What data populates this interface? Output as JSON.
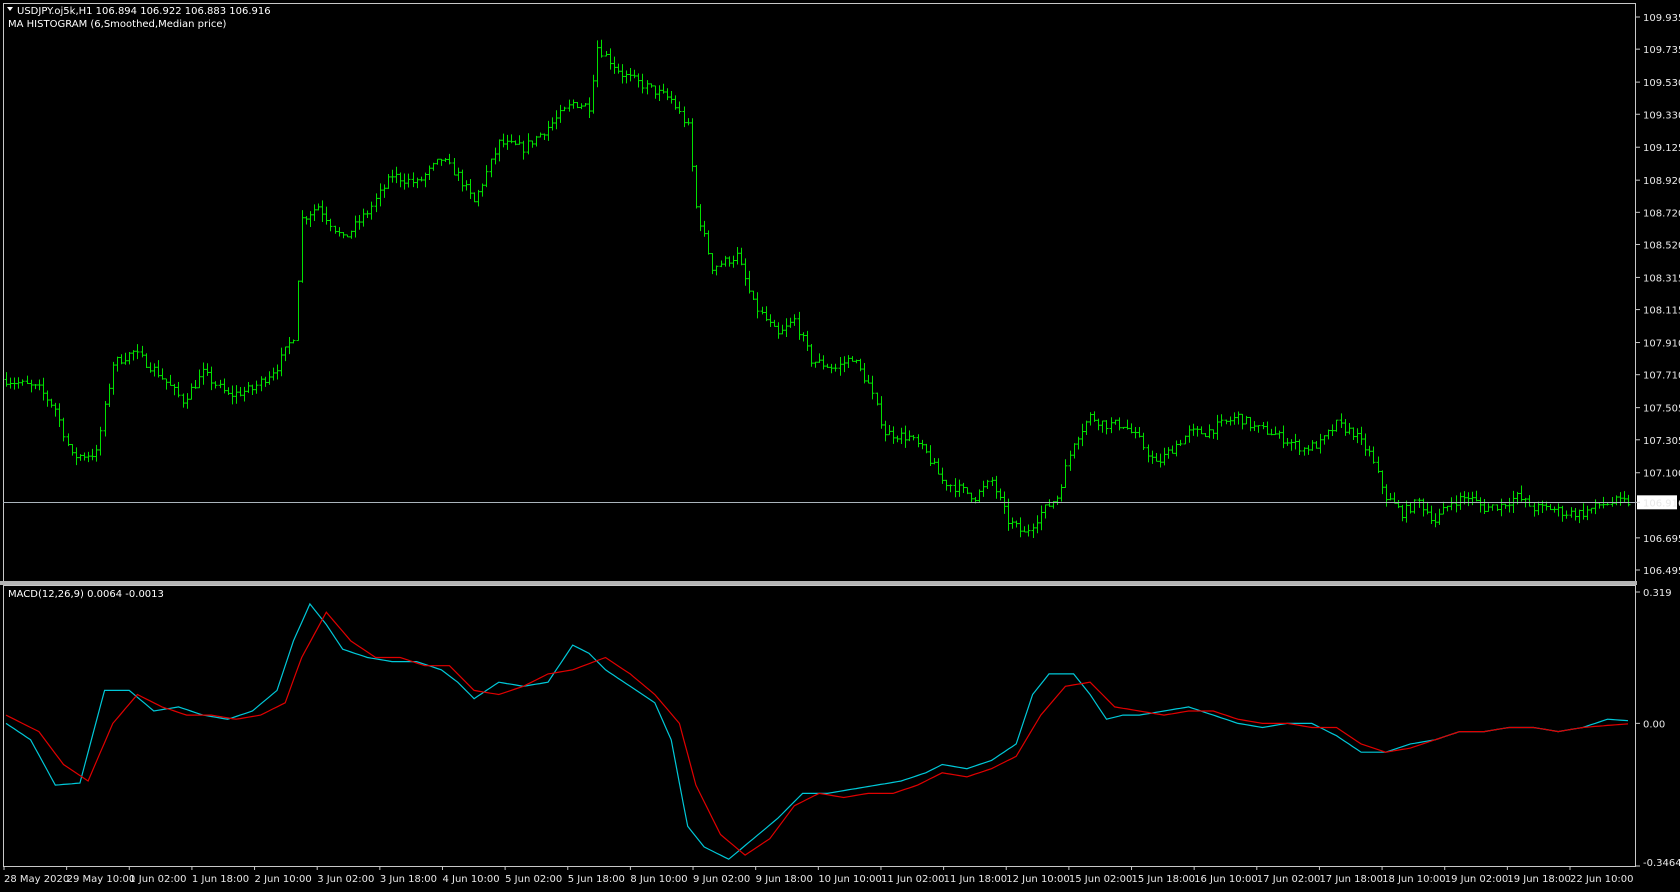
{
  "window": {
    "symbol_line": "USDJPY.oj5k,H1  106.894 106.922 106.883 106.916",
    "indicator_line": "MA HISTOGRAM (6,Smoothed,Median price)"
  },
  "colors": {
    "background": "#000000",
    "candles": "#00e000",
    "macd_main": "#00c8d8",
    "macd_signal": "#e00000",
    "axis_text": "#e8e8e8",
    "current_price_line": "#aab4bc",
    "separator": "#b4b4b4"
  },
  "chart_data": [
    {
      "type": "ohlc",
      "name": "price",
      "title": "USDJPY.oj5k,H1  106.894 106.922 106.883 106.916",
      "ylim": [
        106.495,
        109.935
      ],
      "current_price": 106.916,
      "y_ticks": [
        "109.935",
        "109.735",
        "109.530",
        "109.330",
        "109.125",
        "108.920",
        "108.720",
        "108.520",
        "108.315",
        "108.115",
        "107.910",
        "107.710",
        "107.505",
        "107.305",
        "107.100",
        "106.916",
        "106.695",
        "106.495"
      ],
      "x_ticks": [
        "28 May 2020",
        "29 May 10:00",
        "1 Jun 02:00",
        "1 Jun 18:00",
        "2 Jun 10:00",
        "3 Jun 02:00",
        "3 Jun 18:00",
        "4 Jun 10:00",
        "5 Jun 02:00",
        "5 Jun 18:00",
        "8 Jun 10:00",
        "9 Jun 02:00",
        "9 Jun 18:00",
        "10 Jun 10:00",
        "11 Jun 02:00",
        "11 Jun 18:00",
        "12 Jun 10:00",
        "15 Jun 02:00",
        "15 Jun 18:00",
        "16 Jun 10:00",
        "17 Jun 02:00",
        "17 Jun 18:00",
        "18 Jun 10:00",
        "19 Jun 02:00",
        "19 Jun 18:00",
        "22 Jun 10:00"
      ],
      "key_points": [
        [
          0,
          107.68
        ],
        [
          8,
          107.62
        ],
        [
          12,
          107.5
        ],
        [
          16,
          107.2
        ],
        [
          22,
          107.22
        ],
        [
          26,
          107.78
        ],
        [
          31,
          107.85
        ],
        [
          37,
          107.72
        ],
        [
          43,
          107.55
        ],
        [
          48,
          107.72
        ],
        [
          54,
          107.58
        ],
        [
          60,
          107.62
        ],
        [
          66,
          107.76
        ],
        [
          70,
          107.95
        ],
        [
          72,
          108.68
        ],
        [
          76,
          108.76
        ],
        [
          82,
          108.55
        ],
        [
          88,
          108.72
        ],
        [
          94,
          108.95
        ],
        [
          100,
          108.9
        ],
        [
          106,
          109.05
        ],
        [
          110,
          108.95
        ],
        [
          114,
          108.78
        ],
        [
          120,
          109.15
        ],
        [
          126,
          109.12
        ],
        [
          132,
          109.25
        ],
        [
          138,
          109.4
        ],
        [
          142,
          109.38
        ],
        [
          144,
          109.75
        ],
        [
          150,
          109.58
        ],
        [
          156,
          109.5
        ],
        [
          162,
          109.42
        ],
        [
          166,
          109.25
        ],
        [
          168,
          108.75
        ],
        [
          172,
          108.38
        ],
        [
          178,
          108.45
        ],
        [
          182,
          108.15
        ],
        [
          188,
          107.95
        ],
        [
          192,
          108.05
        ],
        [
          196,
          107.8
        ],
        [
          202,
          107.75
        ],
        [
          206,
          107.82
        ],
        [
          210,
          107.65
        ],
        [
          214,
          107.35
        ],
        [
          220,
          107.32
        ],
        [
          224,
          107.22
        ],
        [
          228,
          107.05
        ],
        [
          232,
          107.0
        ],
        [
          236,
          106.95
        ],
        [
          240,
          107.05
        ],
        [
          244,
          106.8
        ],
        [
          248,
          106.72
        ],
        [
          252,
          106.85
        ],
        [
          256,
          106.95
        ],
        [
          260,
          107.3
        ],
        [
          264,
          107.45
        ],
        [
          268,
          107.4
        ],
        [
          272,
          107.4
        ],
        [
          276,
          107.3
        ],
        [
          280,
          107.15
        ],
        [
          284,
          107.25
        ],
        [
          288,
          107.35
        ],
        [
          292,
          107.35
        ],
        [
          296,
          107.4
        ],
        [
          300,
          107.45
        ],
        [
          304,
          107.38
        ],
        [
          308,
          107.35
        ],
        [
          312,
          107.3
        ],
        [
          316,
          107.25
        ],
        [
          320,
          107.28
        ],
        [
          324,
          107.4
        ],
        [
          328,
          107.35
        ],
        [
          332,
          107.22
        ],
        [
          336,
          106.95
        ],
        [
          340,
          106.85
        ],
        [
          344,
          106.92
        ],
        [
          348,
          106.8
        ],
        [
          352,
          106.92
        ],
        [
          356,
          106.95
        ],
        [
          360,
          106.88
        ],
        [
          364,
          106.9
        ],
        [
          368,
          106.95
        ],
        [
          372,
          106.88
        ],
        [
          376,
          106.88
        ],
        [
          380,
          106.85
        ],
        [
          384,
          106.85
        ],
        [
          388,
          106.9
        ],
        [
          392,
          106.92
        ],
        [
          395,
          106.916
        ]
      ]
    },
    {
      "type": "line",
      "name": "macd",
      "title": "MACD(12,26,9) 0.0064 -0.0013",
      "ylim": [
        -0.3464,
        0.319
      ],
      "y_ticks": [
        "0.319",
        "0.00",
        "-0.3464"
      ],
      "series": [
        {
          "name": "main",
          "values": [
            [
              0,
              0.0
            ],
            [
              6,
              -0.04
            ],
            [
              12,
              -0.15
            ],
            [
              18,
              -0.145
            ],
            [
              24,
              0.08
            ],
            [
              30,
              0.08
            ],
            [
              36,
              0.03
            ],
            [
              42,
              0.04
            ],
            [
              48,
              0.02
            ],
            [
              54,
              0.01
            ],
            [
              60,
              0.03
            ],
            [
              66,
              0.08
            ],
            [
              70,
              0.2
            ],
            [
              74,
              0.29
            ],
            [
              78,
              0.24
            ],
            [
              82,
              0.18
            ],
            [
              88,
              0.16
            ],
            [
              94,
              0.15
            ],
            [
              100,
              0.15
            ],
            [
              106,
              0.13
            ],
            [
              110,
              0.1
            ],
            [
              114,
              0.06
            ],
            [
              120,
              0.1
            ],
            [
              126,
              0.09
            ],
            [
              132,
              0.1
            ],
            [
              138,
              0.19
            ],
            [
              142,
              0.17
            ],
            [
              146,
              0.13
            ],
            [
              152,
              0.09
            ],
            [
              158,
              0.05
            ],
            [
              162,
              -0.04
            ],
            [
              166,
              -0.25
            ],
            [
              170,
              -0.3
            ],
            [
              176,
              -0.33
            ],
            [
              182,
              -0.28
            ],
            [
              188,
              -0.23
            ],
            [
              194,
              -0.17
            ],
            [
              200,
              -0.17
            ],
            [
              206,
              -0.16
            ],
            [
              212,
              -0.15
            ],
            [
              218,
              -0.14
            ],
            [
              224,
              -0.12
            ],
            [
              228,
              -0.1
            ],
            [
              234,
              -0.11
            ],
            [
              240,
              -0.09
            ],
            [
              246,
              -0.05
            ],
            [
              250,
              0.07
            ],
            [
              254,
              0.12
            ],
            [
              260,
              0.12
            ],
            [
              264,
              0.07
            ],
            [
              268,
              0.01
            ],
            [
              272,
              0.02
            ],
            [
              276,
              0.02
            ],
            [
              282,
              0.03
            ],
            [
              288,
              0.04
            ],
            [
              294,
              0.02
            ],
            [
              300,
              0.0
            ],
            [
              306,
              -0.01
            ],
            [
              312,
              0.0
            ],
            [
              318,
              0.0
            ],
            [
              324,
              -0.03
            ],
            [
              330,
              -0.07
            ],
            [
              336,
              -0.07
            ],
            [
              342,
              -0.05
            ],
            [
              348,
              -0.04
            ],
            [
              354,
              -0.02
            ],
            [
              360,
              -0.02
            ],
            [
              366,
              -0.01
            ],
            [
              372,
              -0.01
            ],
            [
              378,
              -0.02
            ],
            [
              384,
              -0.01
            ],
            [
              390,
              0.01
            ],
            [
              395,
              0.0064
            ]
          ]
        },
        {
          "name": "signal",
          "values": [
            [
              0,
              0.02
            ],
            [
              8,
              -0.02
            ],
            [
              14,
              -0.1
            ],
            [
              20,
              -0.14
            ],
            [
              26,
              0.0
            ],
            [
              32,
              0.07
            ],
            [
              38,
              0.04
            ],
            [
              44,
              0.02
            ],
            [
              50,
              0.02
            ],
            [
              56,
              0.01
            ],
            [
              62,
              0.02
            ],
            [
              68,
              0.05
            ],
            [
              72,
              0.16
            ],
            [
              78,
              0.27
            ],
            [
              84,
              0.2
            ],
            [
              90,
              0.16
            ],
            [
              96,
              0.16
            ],
            [
              102,
              0.14
            ],
            [
              108,
              0.14
            ],
            [
              114,
              0.08
            ],
            [
              120,
              0.07
            ],
            [
              126,
              0.09
            ],
            [
              132,
              0.12
            ],
            [
              138,
              0.13
            ],
            [
              146,
              0.16
            ],
            [
              152,
              0.12
            ],
            [
              158,
              0.07
            ],
            [
              164,
              0.0
            ],
            [
              168,
              -0.15
            ],
            [
              174,
              -0.27
            ],
            [
              180,
              -0.32
            ],
            [
              186,
              -0.28
            ],
            [
              192,
              -0.2
            ],
            [
              198,
              -0.17
            ],
            [
              204,
              -0.18
            ],
            [
              210,
              -0.17
            ],
            [
              216,
              -0.17
            ],
            [
              222,
              -0.15
            ],
            [
              228,
              -0.12
            ],
            [
              234,
              -0.13
            ],
            [
              240,
              -0.11
            ],
            [
              246,
              -0.08
            ],
            [
              252,
              0.02
            ],
            [
              258,
              0.09
            ],
            [
              264,
              0.1
            ],
            [
              270,
              0.04
            ],
            [
              276,
              0.03
            ],
            [
              282,
              0.02
            ],
            [
              288,
              0.03
            ],
            [
              294,
              0.03
            ],
            [
              300,
              0.01
            ],
            [
              306,
              0.0
            ],
            [
              312,
              0.0
            ],
            [
              318,
              -0.01
            ],
            [
              324,
              -0.01
            ],
            [
              330,
              -0.05
            ],
            [
              336,
              -0.07
            ],
            [
              342,
              -0.06
            ],
            [
              348,
              -0.04
            ],
            [
              354,
              -0.02
            ],
            [
              360,
              -0.02
            ],
            [
              366,
              -0.01
            ],
            [
              372,
              -0.01
            ],
            [
              378,
              -0.02
            ],
            [
              384,
              -0.01
            ],
            [
              390,
              -0.005
            ],
            [
              395,
              -0.0013
            ]
          ]
        }
      ]
    }
  ]
}
